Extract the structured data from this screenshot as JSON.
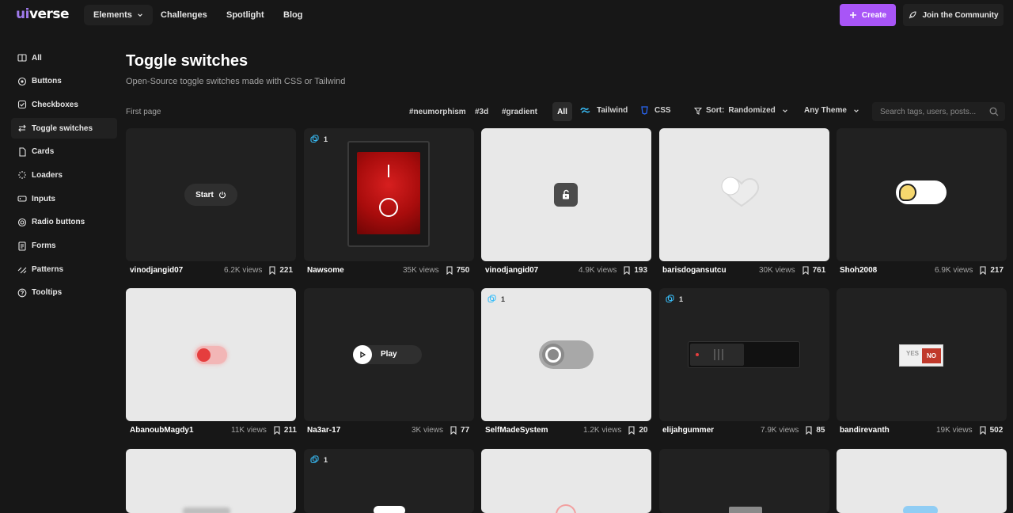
{
  "header": {
    "logo": {
      "ui": "ui",
      "verse": "verse"
    },
    "nav": {
      "elements": "Elements",
      "challenges": "Challenges",
      "spotlight": "Spotlight",
      "blog": "Blog"
    },
    "create": "Create",
    "join": "Join the Community"
  },
  "sidebar": {
    "items": [
      {
        "label": "All"
      },
      {
        "label": "Buttons"
      },
      {
        "label": "Checkboxes"
      },
      {
        "label": "Toggle switches",
        "active": true
      },
      {
        "label": "Cards"
      },
      {
        "label": "Loaders"
      },
      {
        "label": "Inputs"
      },
      {
        "label": "Radio buttons"
      },
      {
        "label": "Forms"
      },
      {
        "label": "Patterns"
      },
      {
        "label": "Tooltips"
      }
    ]
  },
  "page": {
    "title": "Toggle switches",
    "subtitle": "Open-Source toggle switches made with CSS or Tailwind",
    "first_page": "First page"
  },
  "filters": {
    "tags": [
      "#neumorphism",
      "#3d",
      "#gradient"
    ],
    "all": "All",
    "tailwind": "Tailwind",
    "css": "CSS",
    "sort_label": "Sort:",
    "sort_value": "Randomized",
    "theme": "Any Theme",
    "search_placeholder": "Search tags, users, posts..."
  },
  "cards": [
    {
      "author": "vinodjangid07",
      "views": "6.2K views",
      "saves": "221",
      "preview_text": "Start"
    },
    {
      "author": "Nawsome",
      "views": "35K views",
      "saves": "750",
      "fork": "1"
    },
    {
      "author": "vinodjangid07",
      "views": "4.9K views",
      "saves": "193"
    },
    {
      "author": "barisdogansutcu",
      "views": "30K views",
      "saves": "761"
    },
    {
      "author": "Shoh2008",
      "views": "6.9K views",
      "saves": "217"
    },
    {
      "author": "AbanoubMagdy1",
      "views": "11K views",
      "saves": "211"
    },
    {
      "author": "Na3ar-17",
      "views": "3K views",
      "saves": "77",
      "preview_text": "Play"
    },
    {
      "author": "SelfMadeSystem",
      "views": "1.2K views",
      "saves": "20",
      "fork": "1"
    },
    {
      "author": "elijahgummer",
      "views": "7.9K views",
      "saves": "85",
      "fork": "1"
    },
    {
      "author": "bandirevanth",
      "views": "19K views",
      "saves": "502",
      "preview_yes": "YES",
      "preview_no": "NO"
    }
  ],
  "row3": {
    "fork": "1"
  },
  "colors": {
    "accent": "#a855f7",
    "bg": "#171717",
    "card_dark": "#212121",
    "card_light": "#e8e8e8",
    "tailwind": "#38bdf8",
    "css": "#2965f1"
  }
}
